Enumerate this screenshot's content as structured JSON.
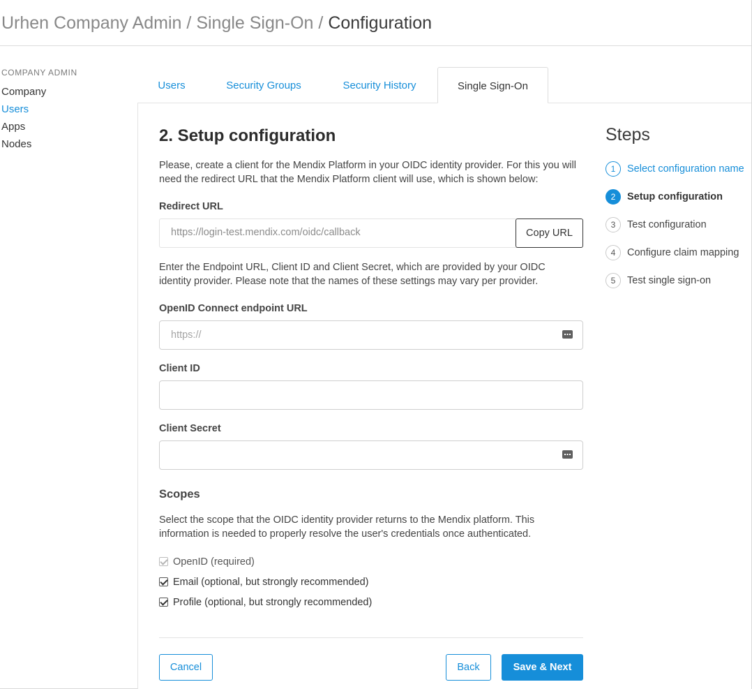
{
  "breadcrumb": {
    "part1": "Urhen Company Admin",
    "sep1": " / ",
    "part2": "Single Sign-On",
    "sep2": " / ",
    "current": "Configuration"
  },
  "sidebar": {
    "heading": "COMPANY ADMIN",
    "items": [
      {
        "label": "Company",
        "active": false
      },
      {
        "label": "Users",
        "active": true
      },
      {
        "label": "Apps",
        "active": false
      },
      {
        "label": "Nodes",
        "active": false
      }
    ]
  },
  "tabs": [
    {
      "label": "Users",
      "active": false
    },
    {
      "label": "Security Groups",
      "active": false
    },
    {
      "label": "Security History",
      "active": false
    },
    {
      "label": "Single Sign-On",
      "active": true
    }
  ],
  "main": {
    "title": "2. Setup configuration",
    "intro": "Please, create a client for the Mendix Platform in your OIDC identity provider. For this you will need the redirect URL that the Mendix Platform client will use, which is shown below:",
    "redirect_label": "Redirect URL",
    "redirect_value": "https://login-test.mendix.com/oidc/callback",
    "copy_button": "Copy URL",
    "endpoint_intro": "Enter the Endpoint URL, Client ID and Client Secret, which are provided by your OIDC identity provider. Please note that the names of these settings may vary per provider.",
    "endpoint_label": "OpenID Connect endpoint URL",
    "endpoint_placeholder": "https://",
    "client_id_label": "Client ID",
    "client_secret_label": "Client Secret",
    "scopes_heading": "Scopes",
    "scopes_intro": "Select the scope that the OIDC identity provider returns to the Mendix platform. This information is needed to properly resolve the user's credentials once authenticated.",
    "scopes": [
      {
        "label": "OpenID (required)",
        "checked": true,
        "disabled": true
      },
      {
        "label": "Email (optional, but strongly recommended)",
        "checked": true,
        "disabled": false
      },
      {
        "label": "Profile (optional, but strongly recommended)",
        "checked": true,
        "disabled": false
      }
    ],
    "cancel_button": "Cancel",
    "back_button": "Back",
    "save_button": "Save & Next"
  },
  "steps": {
    "title": "Steps",
    "items": [
      {
        "num": "1",
        "label": "Select configuration name",
        "state": "done"
      },
      {
        "num": "2",
        "label": "Setup configuration",
        "state": "current"
      },
      {
        "num": "3",
        "label": "Test configuration",
        "state": "pending"
      },
      {
        "num": "4",
        "label": "Configure claim mapping",
        "state": "pending"
      },
      {
        "num": "5",
        "label": "Test single sign-on",
        "state": "pending"
      }
    ]
  },
  "colors": {
    "accent": "#168ed9",
    "text": "#333333",
    "muted": "#888888",
    "border": "#dcdcdc"
  }
}
